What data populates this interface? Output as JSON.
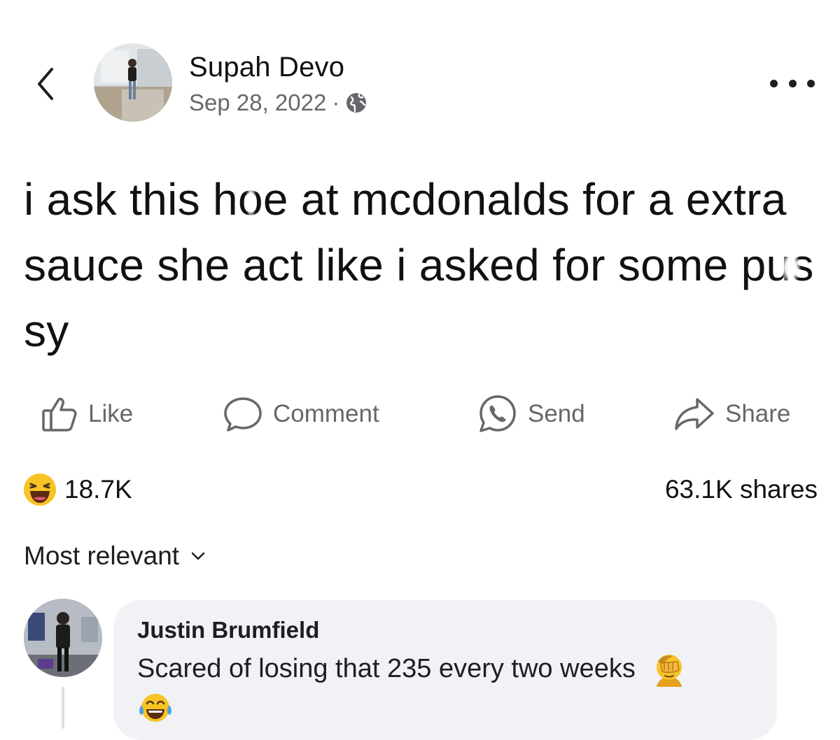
{
  "post": {
    "author": "Supah Devo",
    "date": "Sep 28, 2022",
    "separator": "·",
    "privacy_icon": "globe-icon",
    "text_segments": [
      "i ask this h",
      "o",
      "e at mcdonalds for a extra sauce she act like i asked for some p",
      "us",
      "sy"
    ]
  },
  "actions": {
    "like": "Like",
    "comment": "Comment",
    "send": "Send",
    "share": "Share"
  },
  "stats": {
    "reaction_icon": "haha-emoji-icon",
    "reaction_count": "18.7K",
    "shares": "63.1K shares"
  },
  "comments_sort": {
    "label": "Most relevant"
  },
  "comment": {
    "author": "Justin Brumfield",
    "text": "Scared of losing that 235 every two weeks",
    "emojis": [
      "facepalm-emoji-icon",
      "tears-of-joy-emoji-icon"
    ]
  },
  "colors": {
    "text": "#1c1e21",
    "secondary": "#65676b",
    "bubble": "#f0f2f5",
    "emoji_yellow": "#f7c325"
  }
}
